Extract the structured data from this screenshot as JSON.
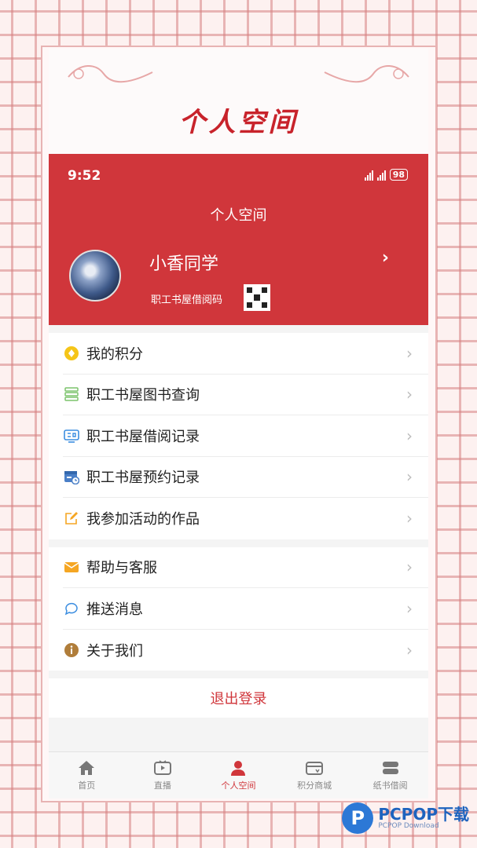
{
  "banner": {
    "title": "个人空间"
  },
  "status": {
    "time": "9:52",
    "battery": "98"
  },
  "header": {
    "title": "个人空间",
    "user_name": "小香同学",
    "card_label": "职工书屋借阅码"
  },
  "menu_group_1": [
    {
      "label": "我的积分",
      "icon": "points-coin-icon"
    },
    {
      "label": "职工书屋图书查询",
      "icon": "book-stack-icon"
    },
    {
      "label": "职工书屋借阅记录",
      "icon": "borrow-record-icon"
    },
    {
      "label": "职工书屋预约记录",
      "icon": "calendar-clock-icon"
    },
    {
      "label": "我参加活动的作品",
      "icon": "edit-icon"
    }
  ],
  "menu_group_2": [
    {
      "label": "帮助与客服",
      "icon": "mail-icon"
    },
    {
      "label": "推送消息",
      "icon": "chat-bubble-icon"
    },
    {
      "label": "关于我们",
      "icon": "info-icon"
    }
  ],
  "logout": {
    "label": "退出登录"
  },
  "tabbar": [
    {
      "label": "首页",
      "icon": "home-icon"
    },
    {
      "label": "直播",
      "icon": "tv-icon"
    },
    {
      "label": "个人空间",
      "icon": "person-icon"
    },
    {
      "label": "积分商城",
      "icon": "wallet-icon"
    },
    {
      "label": "纸书借阅",
      "icon": "books-icon"
    }
  ],
  "watermark": {
    "brand": "PCPOP下载",
    "sub": "PCPOP Download"
  },
  "colors": {
    "accent": "#d0363b",
    "background": "#f4f4f4"
  }
}
